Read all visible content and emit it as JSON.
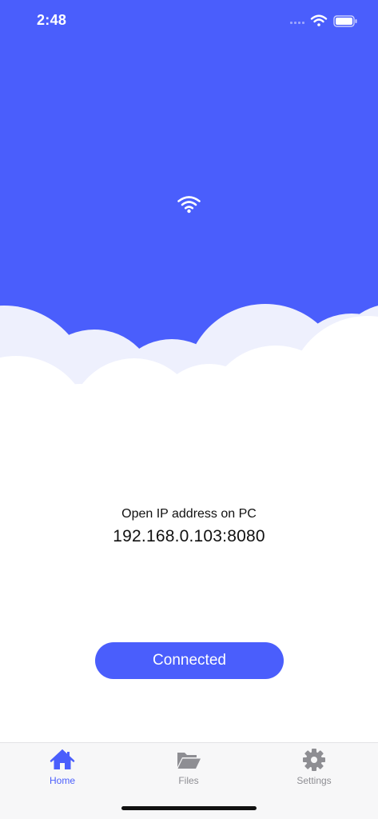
{
  "status_bar": {
    "time": "2:48"
  },
  "hero": {
    "icon": "wifi-icon"
  },
  "info": {
    "caption": "Open IP address on PC",
    "address": "192.168.0.103:8080"
  },
  "action": {
    "label": "Connected"
  },
  "tabs": [
    {
      "label": "Home",
      "icon": "home-icon",
      "active": true
    },
    {
      "label": "Files",
      "icon": "folder-open-icon",
      "active": false
    },
    {
      "label": "Settings",
      "icon": "gear-icon",
      "active": false
    }
  ],
  "colors": {
    "accent": "#4a5efc",
    "cloud_back": "#eef0fd",
    "inactive": "#8e8e93"
  }
}
